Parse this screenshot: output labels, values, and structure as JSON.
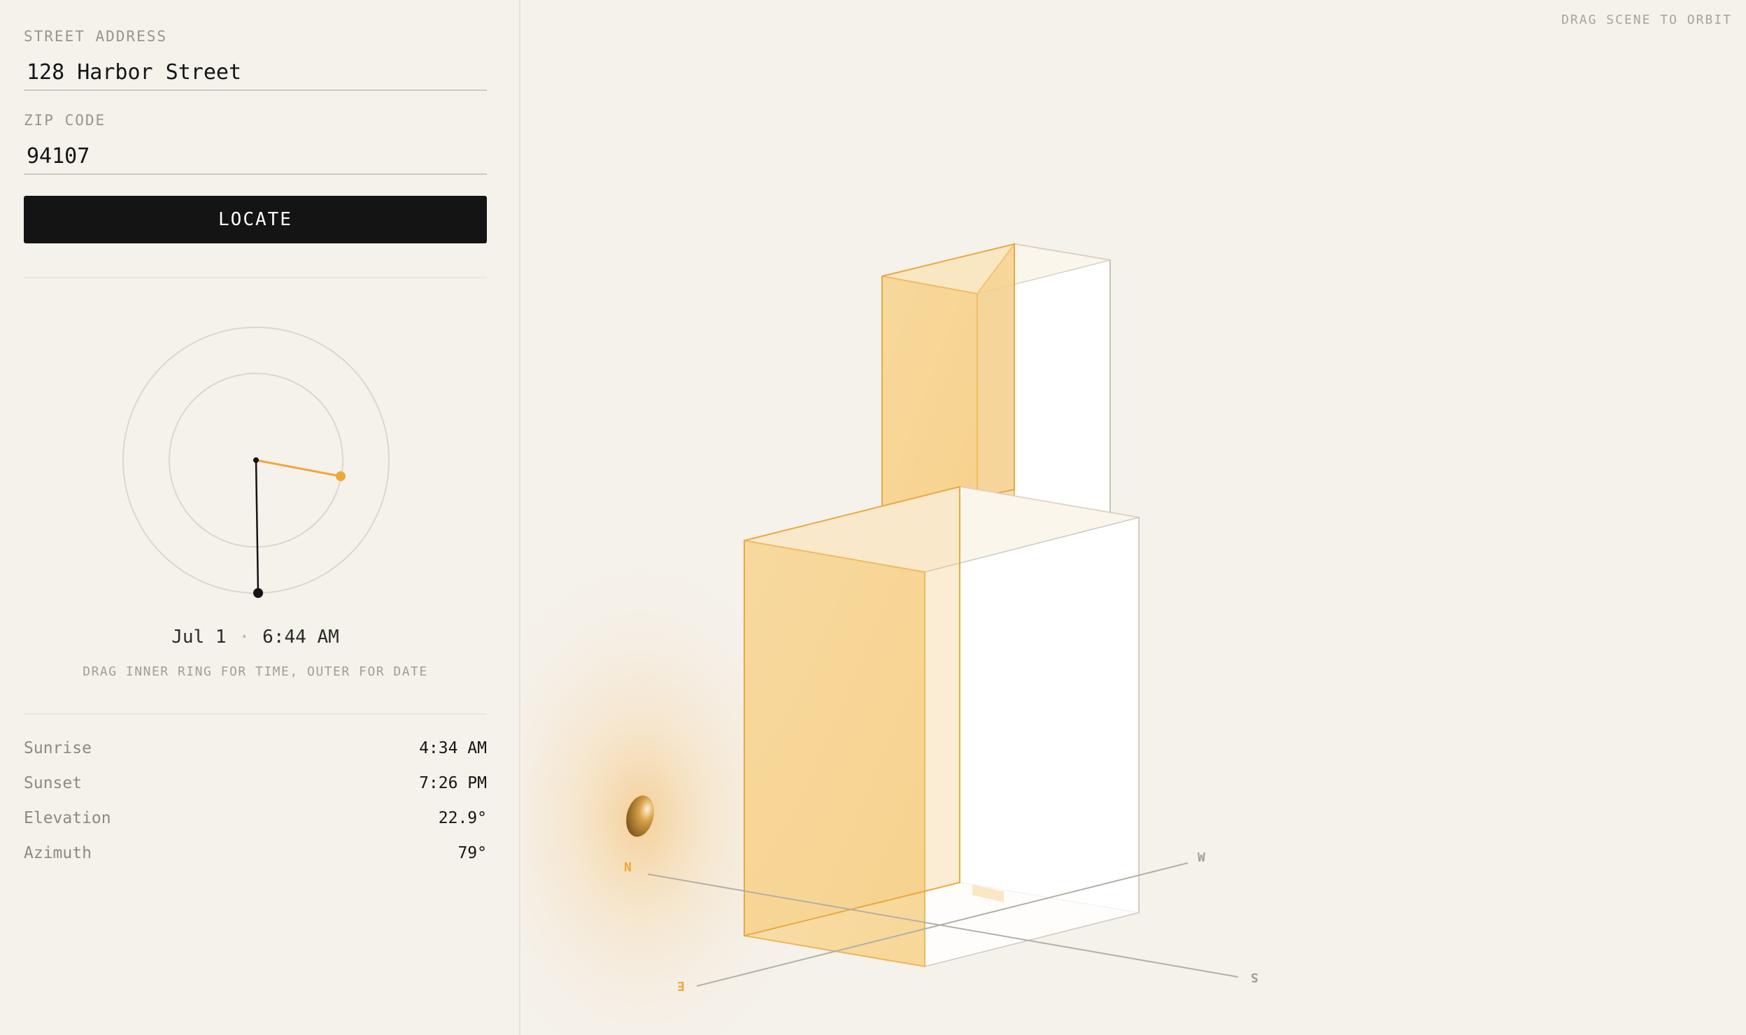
{
  "form": {
    "address_label": "STREET ADDRESS",
    "address_value": "128 Harbor Street",
    "zip_label": "ZIP CODE",
    "zip_value": "94107",
    "locate_label": "LOCATE"
  },
  "dial": {
    "date": "Jul 1",
    "separator": "·",
    "time": "6:44 AM",
    "hint": "DRAG INNER RING FOR TIME, OUTER FOR DATE"
  },
  "stats": [
    {
      "label": "Sunrise",
      "value": "4:34 AM"
    },
    {
      "label": "Sunset",
      "value": "7:26 PM"
    },
    {
      "label": "Elevation",
      "value": "22.9°"
    },
    {
      "label": "Azimuth",
      "value": "79°"
    }
  ],
  "scene": {
    "orbit_hint": "DRAG SCENE TO ORBIT",
    "compass": {
      "n": "N",
      "e": "E",
      "s": "S",
      "w": "W"
    }
  },
  "colors": {
    "accent": "#f0a73a",
    "ink": "#141414",
    "background": "#f5f1eb"
  }
}
